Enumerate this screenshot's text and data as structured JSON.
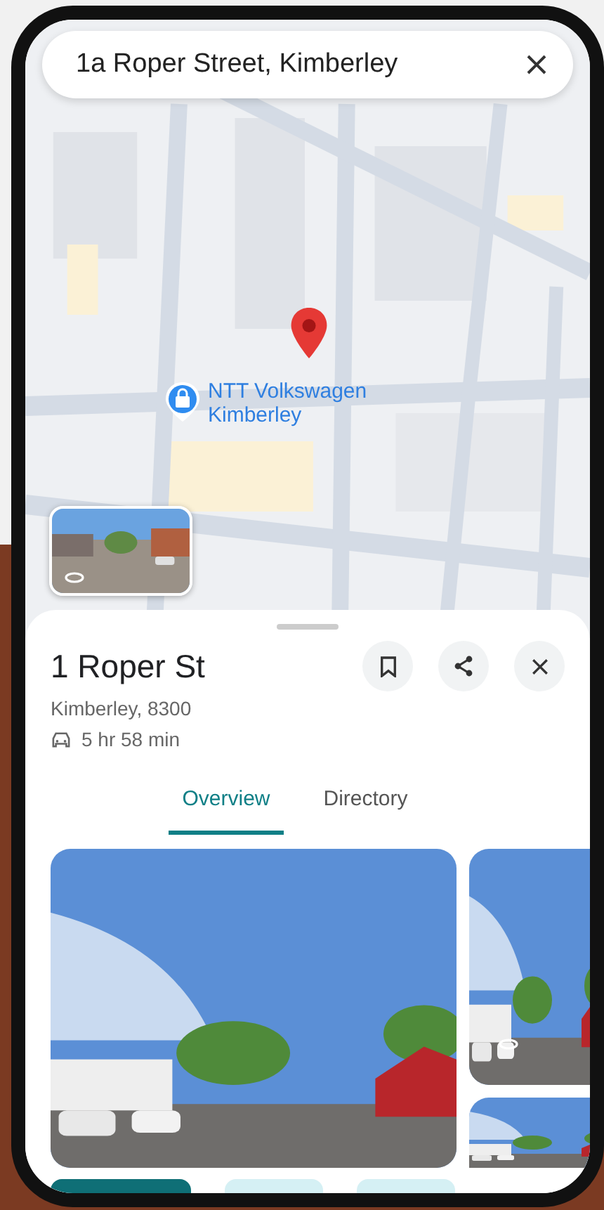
{
  "search": {
    "value": "1a Roper Street, Kimberley"
  },
  "map": {
    "kind": "picture",
    "poi": {
      "label": "NTT Volkswagen Kimberley"
    }
  },
  "place": {
    "title": "1 Roper St",
    "address": "Kimberley, 8300",
    "drive_time": "5 hr 58 min"
  },
  "tabs": [
    {
      "label": "Overview",
      "selected": true
    },
    {
      "label": "Directory",
      "selected": false
    }
  ]
}
